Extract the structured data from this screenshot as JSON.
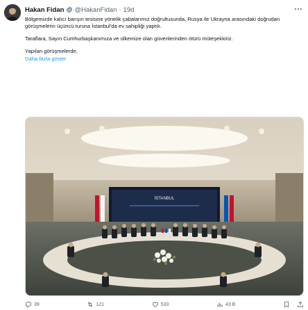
{
  "user": {
    "display_name": "Hakan Fidan",
    "handle": "@HakanFidan",
    "separator": "·",
    "time": "19d"
  },
  "tweet": {
    "paragraphs": [
      "Bölgemizde kalıcı barışın tesisine yönelik çabalarımız doğrultusunda, Rusya ile Ukrayna arasındaki doğrudan görüşmelerin üçüncü turuna İstanbul'da ev sahipliği yaptık.",
      "Taraflara, Sayın Cumhurbaşkanımıza ve ülkemize olan güvenlerinden ötürü müteşekkiriz.",
      "Yapılan görüşmelerde,"
    ],
    "show_more": "Daha fazla göster"
  },
  "media": {
    "screen_label": "İSTANBUL"
  },
  "actions": {
    "reply_count": "39",
    "retweet_count": "121",
    "like_count": "533",
    "views_count": "43 B"
  },
  "icons": {
    "verified": "verified-badge-icon",
    "more": "more-icon",
    "reply": "reply-icon",
    "retweet": "retweet-icon",
    "like": "heart-icon",
    "views": "views-icon",
    "bookmark": "bookmark-icon",
    "share": "share-icon"
  },
  "colors": {
    "accent": "#1d9bf0",
    "muted": "#536471",
    "text": "#0f1419"
  }
}
